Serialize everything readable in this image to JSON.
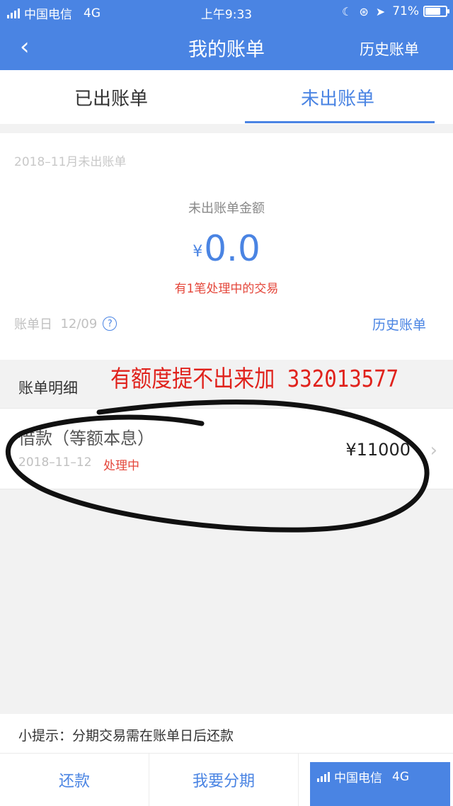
{
  "status_bar": {
    "carrier": "中国电信",
    "network": "4G",
    "time": "上午9:33",
    "battery": "71%"
  },
  "nav": {
    "back_icon": "‹",
    "title": "我的账单",
    "right_link": "历史账单"
  },
  "tabs": {
    "issued": "已出账单",
    "unissued": "未出账单"
  },
  "summary": {
    "period": "2018–11月未出账单",
    "amount_label": "未出账单金额",
    "currency": "¥",
    "amount": "0.0",
    "pending_note": "有1笔处理中的交易",
    "bill_day_label": "账单日",
    "bill_day": "12/09",
    "help_icon": "?",
    "history_link": "历史账单"
  },
  "section": {
    "label": "账单明细",
    "overlay_text": "有额度提不出来加  332013577"
  },
  "transaction": {
    "title": "借款（等额本息）",
    "date": "2018–11–12",
    "status": "处理中",
    "amount": "¥11000",
    "chevron": "›"
  },
  "tip": "小提示：分期交易需在账单日后还款",
  "bottom_buttons": {
    "repay": "还款",
    "installment": "我要分期"
  },
  "overlay_status": {
    "carrier": "中国电信",
    "network": "4G"
  },
  "colors": {
    "primary": "#4a84e3",
    "alert": "#e4463a",
    "overlay_red": "#e0221c"
  }
}
